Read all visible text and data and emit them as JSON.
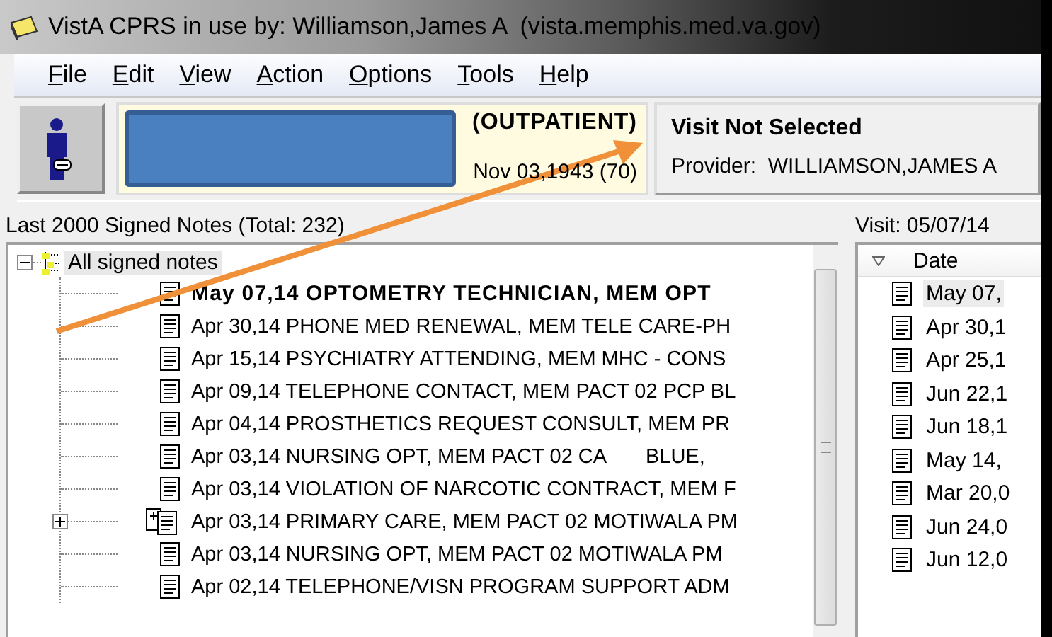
{
  "window": {
    "title": "VistA CPRS in use by: Williamson,James A  (vista.memphis.med.va.gov)"
  },
  "menu": [
    {
      "key": "F",
      "rest": "ile"
    },
    {
      "key": "E",
      "rest": "dit"
    },
    {
      "key": "V",
      "rest": "iew"
    },
    {
      "key": "A",
      "rest": "ction"
    },
    {
      "key": "O",
      "rest": "ptions"
    },
    {
      "key": "T",
      "rest": "ools"
    },
    {
      "key": "H",
      "rest": "elp"
    }
  ],
  "patient": {
    "location": "(OUTPATIENT)",
    "birth": "Nov 03,1943 (70)"
  },
  "visit": {
    "title": "Visit Not Selected",
    "provider_label": "Provider:",
    "provider": "WILLIAMSON,JAMES A"
  },
  "notes": {
    "heading": "Last 2000 Signed Notes (Total: 232)",
    "root": {
      "label": "All signed notes",
      "expanded": true,
      "children": [
        {
          "kind": "note",
          "bold": true,
          "date": "May 07,14",
          "title": "OPTOMETRY TECHNICIAN, MEM OPT"
        },
        {
          "kind": "note",
          "bold": false,
          "date": "Apr 30,14",
          "title": "PHONE MED RENEWAL, MEM TELE CARE-PH"
        },
        {
          "kind": "note",
          "bold": false,
          "date": "Apr 15,14",
          "title": "PSYCHIATRY ATTENDING, MEM MHC - CONS"
        },
        {
          "kind": "note",
          "bold": false,
          "date": "Apr 09,14",
          "title": "TELEPHONE CONTACT, MEM PACT 02 PCP BL"
        },
        {
          "kind": "note",
          "bold": false,
          "date": "Apr 04,14",
          "title": "PROSTHETICS REQUEST CONSULT, MEM PR"
        },
        {
          "kind": "note",
          "bold": false,
          "date": "Apr 03,14",
          "title": "NURSING OPT, MEM PACT 02 CA       BLUE,"
        },
        {
          "kind": "note",
          "bold": false,
          "date": "Apr 03,14",
          "title": "VIOLATION OF NARCOTIC CONTRACT, MEM F"
        },
        {
          "kind": "group",
          "expanded": false,
          "bold": false,
          "date": "Apr 03,14",
          "title": "PRIMARY CARE, MEM PACT 02 MOTIWALA PM"
        },
        {
          "kind": "note",
          "bold": false,
          "date": "Apr 03,14",
          "title": "NURSING OPT, MEM PACT 02 MOTIWALA PM"
        },
        {
          "kind": "note",
          "bold": false,
          "date": "Apr 02,14",
          "title": "TELEPHONE/VISN PROGRAM SUPPORT ADM"
        }
      ]
    }
  },
  "visits": {
    "heading": "Visit: 05/07/14",
    "column": "Date",
    "rows": [
      {
        "label": "May 07,",
        "selected": true
      },
      {
        "label": "Apr 30,1",
        "selected": false
      },
      {
        "label": "Apr 25,1",
        "selected": false
      },
      {
        "label": "Jun 22,1",
        "selected": false
      },
      {
        "label": "Jun 18,1",
        "selected": false
      },
      {
        "label": "May 14,",
        "selected": false
      },
      {
        "label": "Mar 20,0",
        "selected": false
      },
      {
        "label": "Jun 24,0",
        "selected": false
      },
      {
        "label": "Jun 12,0",
        "selected": false
      }
    ]
  }
}
